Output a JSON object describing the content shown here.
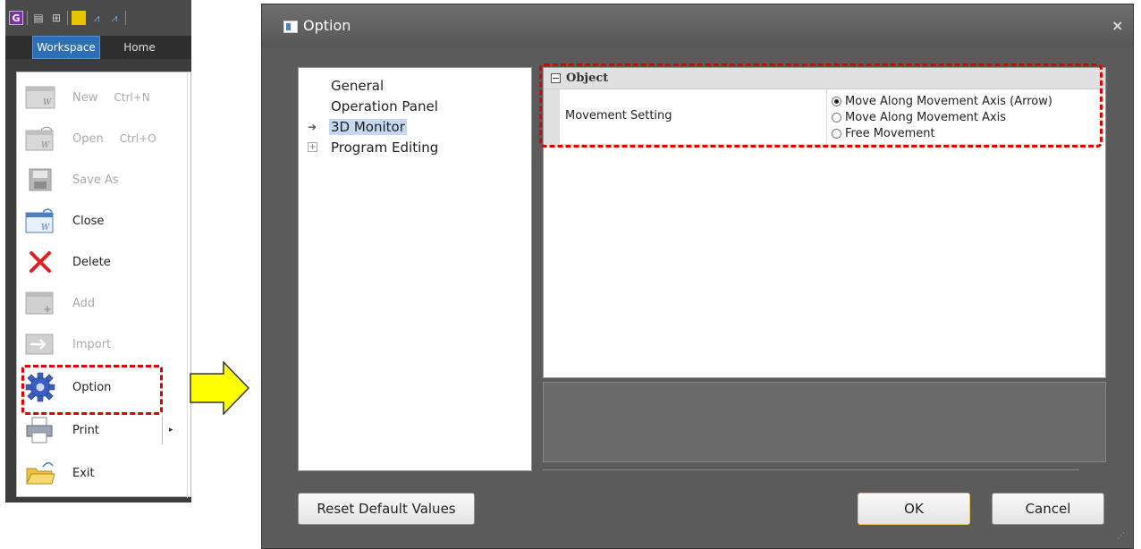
{
  "ribbon": {
    "tabs": [
      "Workspace",
      "Home"
    ],
    "active_tab": "Workspace"
  },
  "file_menu": {
    "items": [
      {
        "label": "New",
        "shortcut": "Ctrl+N",
        "icon": "new-workspace-icon",
        "enabled": false
      },
      {
        "label": "Open",
        "shortcut": "Ctrl+O",
        "icon": "open-workspace-icon",
        "enabled": false
      },
      {
        "label": "Save As",
        "shortcut": "",
        "icon": "save-as-icon",
        "enabled": false
      },
      {
        "label": "Close",
        "shortcut": "",
        "icon": "close-workspace-icon",
        "enabled": true
      },
      {
        "label": "Delete",
        "shortcut": "",
        "icon": "delete-x-icon",
        "enabled": true
      },
      {
        "label": "Add",
        "shortcut": "",
        "icon": "add-workspace-icon",
        "enabled": false
      },
      {
        "label": "Import",
        "shortcut": "",
        "icon": "import-icon",
        "enabled": false
      },
      {
        "label": "Option",
        "shortcut": "",
        "icon": "gear-icon",
        "enabled": true
      },
      {
        "label": "Print",
        "shortcut": "",
        "icon": "printer-icon",
        "enabled": true,
        "submenu_glyph": "▸"
      },
      {
        "label": "Exit",
        "shortcut": "",
        "icon": "exit-folder-icon",
        "enabled": true
      }
    ]
  },
  "dialog": {
    "title": "Option",
    "close_glyph": "×",
    "tree": {
      "items": [
        {
          "label": "General",
          "marker": ""
        },
        {
          "label": "Operation Panel",
          "marker": ""
        },
        {
          "label": "3D Monitor",
          "marker": "➔",
          "selected": true
        },
        {
          "label": "Program Editing",
          "marker": "+"
        }
      ]
    },
    "properties": {
      "category": {
        "toggle": "−",
        "label": "Object"
      },
      "rows": [
        {
          "name": "Movement Setting",
          "options": [
            {
              "label": "Move Along Movement Axis (Arrow)",
              "checked": true
            },
            {
              "label": "Move Along Movement Axis",
              "checked": false
            },
            {
              "label": "Free Movement",
              "checked": false
            }
          ]
        }
      ]
    },
    "buttons": {
      "reset": "Reset Default Values",
      "ok": "OK",
      "cancel": "Cancel"
    },
    "grip_glyph": "⋰"
  },
  "colors": {
    "highlight_dash": "#e10000",
    "arrow_fill": "#ffff00",
    "selection": "#c4d9f1",
    "workspace_tab": "#2d6fb7"
  }
}
